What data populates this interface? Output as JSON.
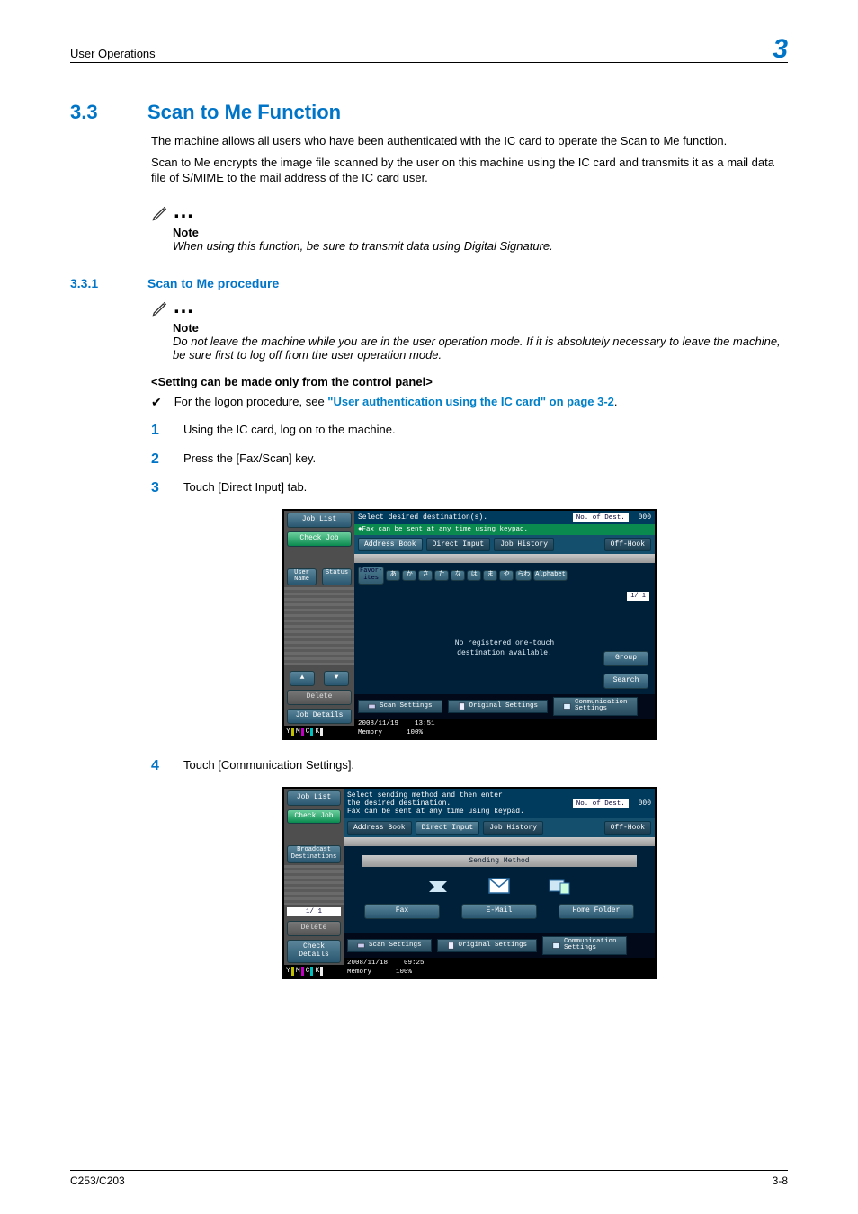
{
  "header": {
    "title": "User Operations",
    "chapter": "3"
  },
  "section": {
    "number": "3.3",
    "title": "Scan to Me Function"
  },
  "paragraphs": {
    "p1": "The machine allows all users who have been authenticated with the IC card to operate the Scan to Me function.",
    "p2": "Scan to Me encrypts the image file scanned by the user on this machine using the IC card and transmits it as a mail data file of S/MIME to the mail address of the IC card user."
  },
  "note1": {
    "label": "Note",
    "body": "When using this function, be sure to transmit data using Digital Signature."
  },
  "subsection": {
    "number": "3.3.1",
    "title": "Scan to Me procedure"
  },
  "note2": {
    "label": "Note",
    "body": "Do not leave the machine while you are in the user operation mode. If it is absolutely necessary to leave the machine, be sure first to log off from the user operation mode."
  },
  "setting_heading": "<Setting can be made only from the control panel>",
  "checkline": {
    "prefix": "For the logon procedure, see ",
    "link": "\"User authentication using the IC card\" on page 3-2",
    "suffix": "."
  },
  "steps": {
    "s1": "Using the IC card, log on to the machine.",
    "s2": "Press the [Fax/Scan] key.",
    "s3": "Touch [Direct Input] tab.",
    "s4": "Touch [Communication Settings]."
  },
  "panel1": {
    "left": {
      "job_list": "Job List",
      "check_job": "Check Job",
      "user_name": "User Name",
      "status": "Status",
      "delete": "Delete",
      "job_details": "Job Details"
    },
    "top_msg": "Select desired destination(s).",
    "dest_label": "No. of Dest.",
    "dest_count": "000",
    "greenstrip": "●Fax can be sent at any time using keypad.",
    "tabs": {
      "address": "Address Book",
      "direct": "Direct Input",
      "history": "Job History",
      "offhook": "Off-Hook"
    },
    "kana": {
      "favor": "Favor-\nites",
      "keys": [
        "あ",
        "か",
        "さ",
        "た",
        "な",
        "は",
        "ま",
        "や",
        "らわ"
      ],
      "alphabet": "Alphabet"
    },
    "pager": "1/  1",
    "canvas_msg": "No registered one-touch\ndestination available.",
    "group": "Group",
    "search": "Search",
    "bottom": {
      "scan": "Scan Settings",
      "original": "Original Settings",
      "comm": "Communication\nSettings"
    },
    "status": {
      "date": "2008/11/19",
      "time": "13:51",
      "mem_label": "Memory",
      "mem_val": "100%"
    }
  },
  "panel2": {
    "left": {
      "job_list": "Job List",
      "check_job": "Check Job",
      "broadcast": "Broadcast\nDestinations",
      "pager": "1/  1",
      "delete": "Delete",
      "check_details": "Check Details"
    },
    "top_msg": "Select sending method and then enter\nthe desired destination.\nFax can be sent at any time using keypad.",
    "dest_label": "No. of Dest.",
    "dest_count": "000",
    "tabs": {
      "address": "Address Book",
      "direct": "Direct Input",
      "history": "Job History",
      "offhook": "Off-Hook"
    },
    "sending_method": "Sending Method",
    "buttons": {
      "fax": "Fax",
      "email": "E-Mail",
      "home": "Home Folder"
    },
    "bottom": {
      "scan": "Scan Settings",
      "original": "Original Settings",
      "comm": "Communication\nSettings"
    },
    "status": {
      "date": "2008/11/18",
      "time": "09:25",
      "mem_label": "Memory",
      "mem_val": "100%"
    }
  },
  "footer": {
    "left": "C253/C203",
    "right": "3-8"
  }
}
